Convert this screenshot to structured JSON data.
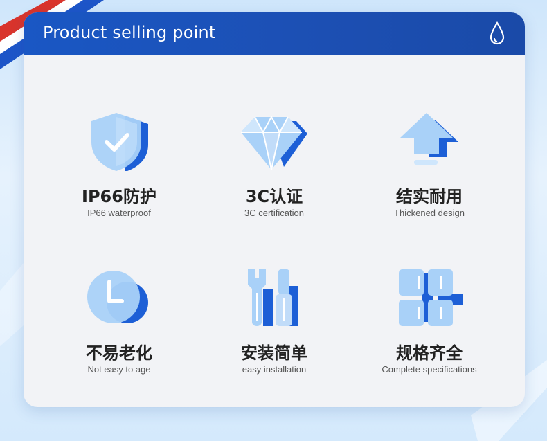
{
  "header": {
    "title": "Product selling point",
    "icon": "water-drop-icon"
  },
  "features": [
    {
      "name_zh": "IP66防护",
      "name_en": "IP66 waterproof",
      "icon": "shield-check-icon"
    },
    {
      "name_zh": "3C认证",
      "name_en": "3C certification",
      "icon": "diamond-icon"
    },
    {
      "name_zh": "结实耐用",
      "name_en": "Thickened design",
      "icon": "arrow-up-icon"
    },
    {
      "name_zh": "不易老化",
      "name_en": "Not easy to age",
      "icon": "clock-icon"
    },
    {
      "name_zh": "安装简单",
      "name_en": "easy installation",
      "icon": "tools-icon"
    },
    {
      "name_zh": "规格齐全",
      "name_en": "Complete specifications",
      "icon": "grid-icon"
    }
  ],
  "colors": {
    "header_blue": "#1a57c4",
    "icon_light": "#9ccaf7",
    "icon_dark": "#1d5fd6",
    "card_bg": "#f2f3f6"
  }
}
